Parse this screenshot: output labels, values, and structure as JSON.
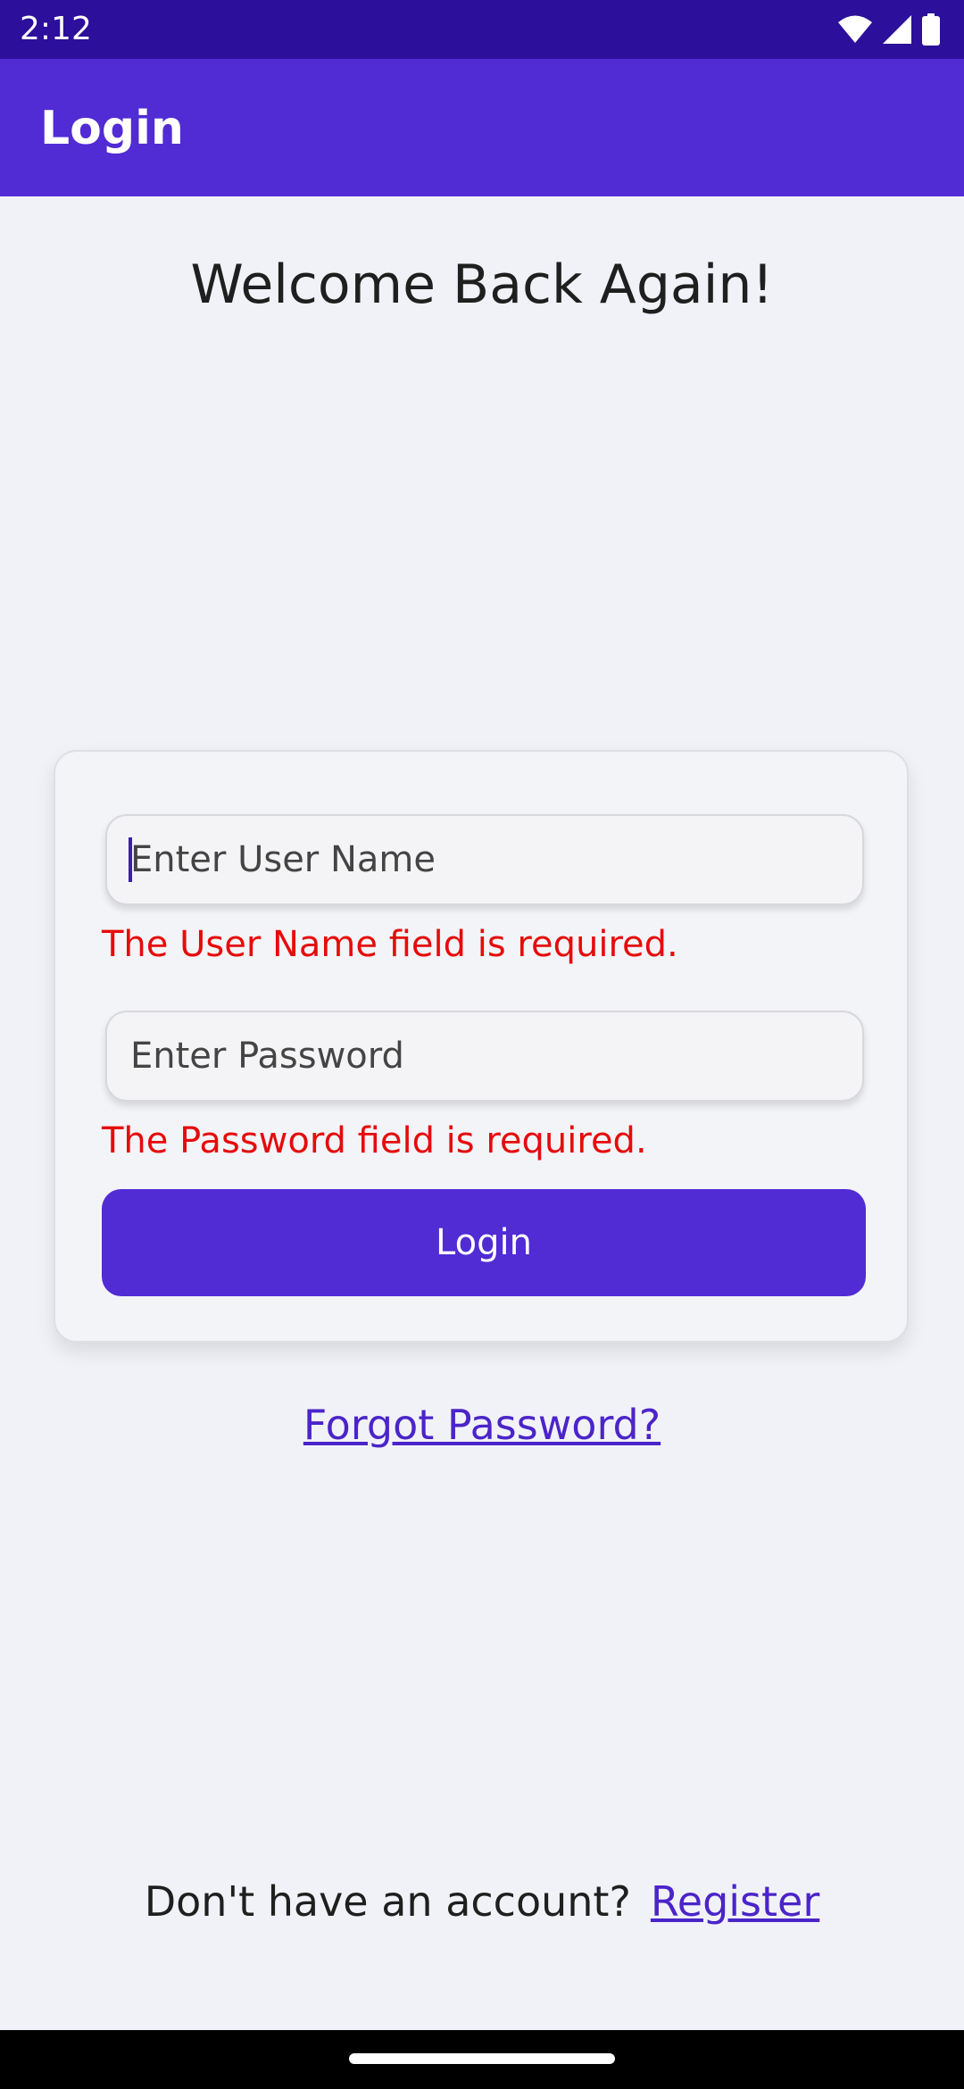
{
  "status_bar": {
    "time": "2:12",
    "icons": [
      "wifi-icon",
      "cellular-signal-icon",
      "battery-icon"
    ],
    "background_color": "#2c0f9a"
  },
  "app_bar": {
    "title": "Login",
    "background_color": "#512bd4"
  },
  "main": {
    "welcome_title": "Welcome Back Again!"
  },
  "form": {
    "username": {
      "placeholder": "Enter User Name",
      "value": "",
      "error": "The User Name field is required."
    },
    "password": {
      "placeholder": "Enter Password",
      "value": "",
      "error": "The Password field is required."
    },
    "login_button_label": "Login",
    "error_color": "#e60b0b",
    "accent_color": "#512bd4"
  },
  "links": {
    "forgot_password": "Forgot Password?",
    "no_account_prompt": "Don't have an account?",
    "register": "Register"
  }
}
